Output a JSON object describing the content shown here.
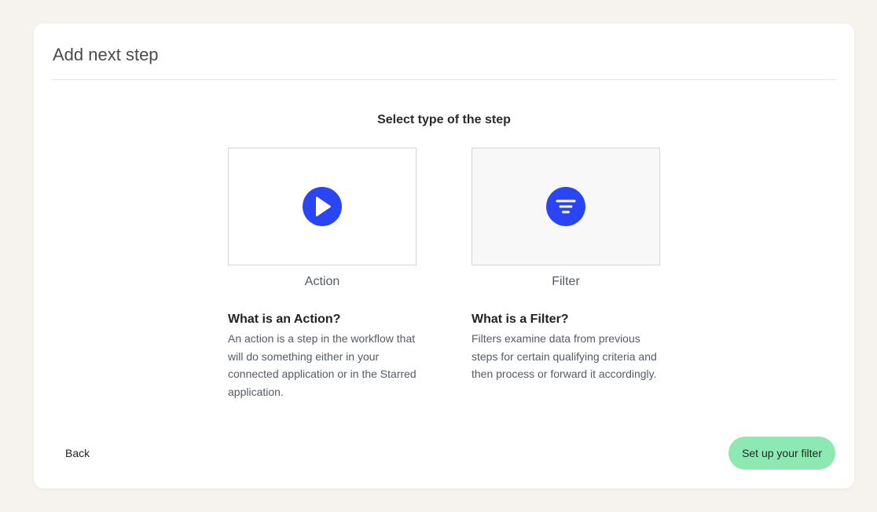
{
  "dialog": {
    "title": "Add next step",
    "section_title": "Select type of the step"
  },
  "options": [
    {
      "label": "Action",
      "icon": "play-icon",
      "selected": false,
      "description_title": "What is an Action?",
      "description_text": "An action is a step in the workflow that will do something either in your connected application or in the Starred application."
    },
    {
      "label": "Filter",
      "icon": "filter-icon",
      "selected": true,
      "description_title": "What is a Filter?",
      "description_text": "Filters examine data from previous steps for certain qualifying criteria and then process or forward it accordingly."
    }
  ],
  "footer": {
    "back_label": "Back",
    "primary_label": "Set up your filter"
  },
  "colors": {
    "background": "#f6f3ee",
    "icon_accent": "#2a45f5",
    "primary_button": "#8de8b2"
  }
}
